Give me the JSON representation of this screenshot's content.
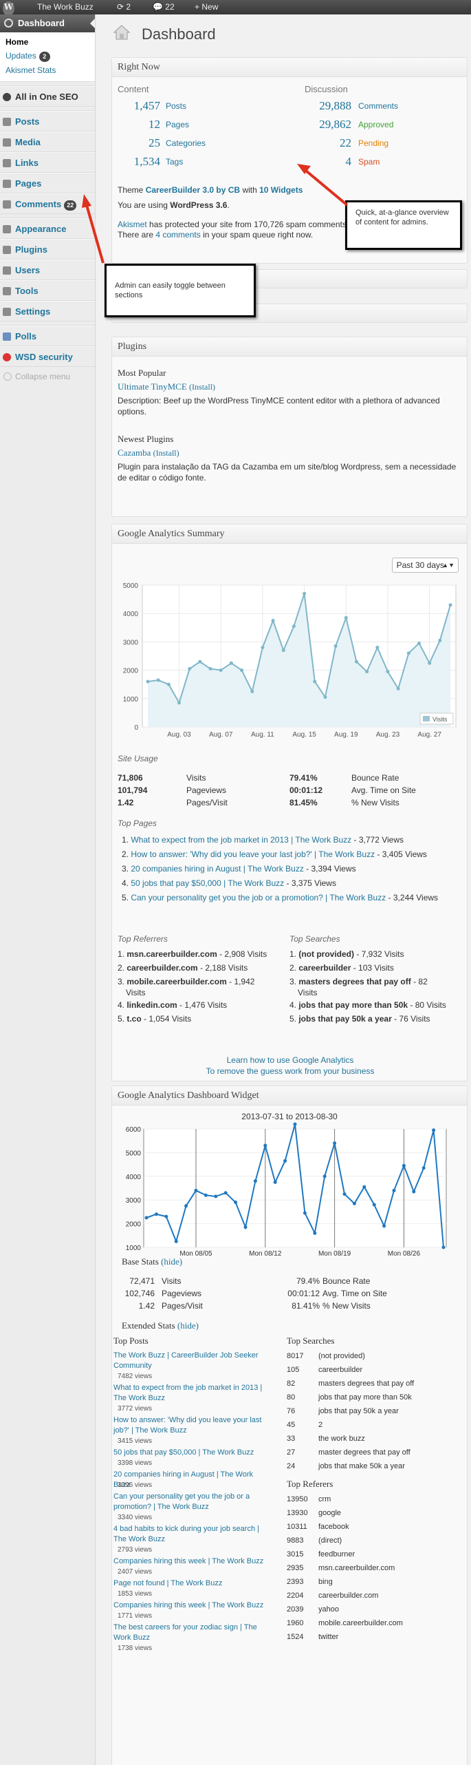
{
  "adminbar": {
    "site": "The Work Buzz",
    "updates": "2",
    "comments": "22",
    "new": "New"
  },
  "sidebar": {
    "dashboard": "Dashboard",
    "sub": [
      {
        "label": "Home"
      },
      {
        "label": "Updates",
        "badge": "2"
      },
      {
        "label": "Akismet Stats"
      }
    ],
    "items": [
      {
        "label": "All in One SEO"
      },
      {
        "label": "Posts"
      },
      {
        "label": "Media"
      },
      {
        "label": "Links"
      },
      {
        "label": "Pages"
      },
      {
        "label": "Comments",
        "badge": "22"
      },
      {
        "label": "Appearance"
      },
      {
        "label": "Plugins"
      },
      {
        "label": "Users"
      },
      {
        "label": "Tools"
      },
      {
        "label": "Settings"
      },
      {
        "label": "Polls"
      },
      {
        "label": "WSD security"
      }
    ],
    "collapse": "Collapse menu"
  },
  "page_title": "Dashboard",
  "right_now": {
    "title": "Right Now",
    "content_head": "Content",
    "discussion_head": "Discussion",
    "content": [
      {
        "n": "1,457",
        "l": "Posts"
      },
      {
        "n": "12",
        "l": "Pages"
      },
      {
        "n": "25",
        "l": "Categories"
      },
      {
        "n": "1,534",
        "l": "Tags"
      }
    ],
    "discussion": [
      {
        "n": "29,888",
        "l": "Comments"
      },
      {
        "n": "29,862",
        "l": "Approved"
      },
      {
        "n": "22",
        "l": "Pending"
      },
      {
        "n": "4",
        "l": "Spam"
      }
    ],
    "theme_pre": "Theme",
    "theme": "CareerBuilder 3.0 by CB",
    "theme_mid": "with",
    "widgets": "10 Widgets",
    "version_pre": "You are using",
    "version": "WordPress 3.6",
    "akismet": "Akismet",
    "akismet_text": "has protected your site from 170,726 spam comments",
    "spam_queue_pre": "There are",
    "spam_queue_link": "4 comments",
    "spam_queue_post": "in your spam queue right now."
  },
  "callouts": {
    "right": "Quick, at-a-glance overview of content for admins.",
    "left": "Admin can easily toggle between sections"
  },
  "plugins": {
    "title": "Plugins",
    "most_popular": "Most Popular",
    "mp_name": "Ultimate TinyMCE",
    "install": "(Install)",
    "mp_desc": "Description: Beef up the WordPress TinyMCE content editor with a plethora of advanced options.",
    "newest": "Newest Plugins",
    "np_name": "Cazamba",
    "np_desc": "Plugin para instalação da TAG da Cazamba em um site/blog Wordpress, sem a necessidade de editar o código fonte."
  },
  "ga_summary": {
    "title": "Google Analytics Summary",
    "range": "Past 30 days",
    "legend": "Visits",
    "site_usage": "Site Usage",
    "stats": [
      {
        "v": "71,806",
        "l": "Visits",
        "v2": "79.41%",
        "l2": "Bounce Rate"
      },
      {
        "v": "101,794",
        "l": "Pageviews",
        "v2": "00:01:12",
        "l2": "Avg. Time on Site"
      },
      {
        "v": "1.42",
        "l": "Pages/Visit",
        "v2": "81.45%",
        "l2": "% New Visits"
      }
    ],
    "top_pages_head": "Top Pages",
    "top_pages": [
      {
        "link": "What to expect from the job market in 2013 | The Work Buzz",
        "views": "- 3,772 Views"
      },
      {
        "link": "How to answer: 'Why did you leave your last job?' | The Work Buzz",
        "views": "- 3,405 Views"
      },
      {
        "link": "20 companies hiring in August | The Work Buzz",
        "views": "- 3,394 Views"
      },
      {
        "link": "50 jobs that pay $50,000 | The Work Buzz",
        "views": "- 3,375 Views"
      },
      {
        "link": "Can your personality get you the job or a promotion? | The Work Buzz",
        "views": "- 3,244 Views"
      }
    ],
    "referrers_head": "Top Referrers",
    "referrers": [
      {
        "b": "msn.careerbuilder.com",
        "v": "- 2,908 Visits"
      },
      {
        "b": "careerbuilder.com",
        "v": "- 2,188 Visits"
      },
      {
        "b": "mobile.careerbuilder.com",
        "v": "- 1,942"
      },
      {
        "b": "linkedin.com",
        "v": "- 1,476 Visits"
      },
      {
        "b": "t.co",
        "v": "- 1,054 Visits"
      }
    ],
    "ref3_cont": "Visits",
    "searches_head": "Top Searches",
    "searches": [
      {
        "b": "(not provided)",
        "v": "- 7,932 Visits"
      },
      {
        "b": "careerbuilder",
        "v": "- 103 Visits"
      },
      {
        "b": "masters degrees that pay off",
        "v": "- 82"
      },
      {
        "b": "jobs that pay more than 50k",
        "v": "- 80 Visits"
      },
      {
        "b": "jobs that pay 50k a year",
        "v": "- 76 Visits"
      }
    ],
    "s3_cont": "Visits",
    "learn": "Learn how to use Google Analytics",
    "remove": "To remove the guess work from your business"
  },
  "ga_widget": {
    "title": "Google Analytics Dashboard Widget",
    "range_title": "2013-07-31 to 2013-08-30",
    "base_stats": "Base Stats",
    "hide": "(hide)",
    "stats": [
      {
        "v": "72,471",
        "l": "Visits",
        "v2": "79.4%",
        "l2": "Bounce Rate"
      },
      {
        "v": "102,746",
        "l": "Pageviews",
        "v2": "00:01:12",
        "l2": "Avg. Time on Site"
      },
      {
        "v": "1.42",
        "l": "Pages/Visit",
        "v2": "81.41%",
        "l2": "% New Visits"
      }
    ],
    "extended": "Extended Stats",
    "top_posts_head": "Top Posts",
    "top_posts": [
      {
        "t": "The Work Buzz | CareerBuilder Job Seeker Community",
        "v": "7482 views"
      },
      {
        "t": "What to expect from the job market in 2013 | The Work Buzz",
        "v": "3772 views"
      },
      {
        "t": "How to answer: 'Why did you leave your last job?' | The Work Buzz",
        "v": "3415 views"
      },
      {
        "t": "50 jobs that pay $50,000 | The Work Buzz",
        "v": "3398 views"
      },
      {
        "t": "20 companies hiring in August | The Work Buzz",
        "v": "3396 views"
      },
      {
        "t": "Can your personality get you the job or a promotion? | The Work Buzz",
        "v": "3340 views"
      },
      {
        "t": "4 bad habits to kick during your job search | The Work Buzz",
        "v": "2793 views"
      },
      {
        "t": "Companies hiring this week | The Work Buzz",
        "v": "2407 views"
      },
      {
        "t": "Page not found | The Work Buzz",
        "v": "1853 views"
      },
      {
        "t": "Companies hiring this week | The Work Buzz",
        "v": "1771 views"
      },
      {
        "t": "The best careers for your zodiac sign | The Work Buzz",
        "v": "1738 views"
      }
    ],
    "top_searches_head": "Top Searches",
    "top_searches": [
      {
        "n": "8017",
        "t": "(not provided)"
      },
      {
        "n": "105",
        "t": "careerbuilder"
      },
      {
        "n": "82",
        "t": "masters degrees that pay off"
      },
      {
        "n": "80",
        "t": "jobs that pay more than 50k"
      },
      {
        "n": "76",
        "t": "jobs that pay 50k a year"
      },
      {
        "n": "45",
        "t": "2"
      },
      {
        "n": "33",
        "t": "the work buzz"
      },
      {
        "n": "27",
        "t": "master degrees that pay off"
      },
      {
        "n": "24",
        "t": "jobs that make 50k a year"
      }
    ],
    "top_referers_head": "Top Referers",
    "top_referers": [
      {
        "n": "13950",
        "t": "crm"
      },
      {
        "n": "13930",
        "t": "google"
      },
      {
        "n": "10311",
        "t": "facebook"
      },
      {
        "n": "9883",
        "t": "(direct)"
      },
      {
        "n": "3015",
        "t": "feedburner"
      },
      {
        "n": "2935",
        "t": "msn.careerbuilder.com"
      },
      {
        "n": "2393",
        "t": "bing"
      },
      {
        "n": "2204",
        "t": "careerbuilder.com"
      },
      {
        "n": "2039",
        "t": "yahoo"
      },
      {
        "n": "1960",
        "t": "mobile.careerbuilder.com"
      },
      {
        "n": "1524",
        "t": "twitter"
      }
    ]
  },
  "chart_data": [
    {
      "type": "area",
      "title": "",
      "xlabel": "",
      "ylabel": "",
      "x_ticks": [
        "Aug. 03",
        "Aug. 07",
        "Aug. 11",
        "Aug. 15",
        "Aug. 19",
        "Aug. 23",
        "Aug. 27"
      ],
      "ylim": [
        0,
        5000
      ],
      "y_ticks": [
        0,
        1000,
        2000,
        3000,
        4000,
        5000
      ],
      "series": [
        {
          "name": "Visits",
          "values": [
            1600,
            1650,
            1500,
            850,
            2050,
            2300,
            2050,
            2000,
            2250,
            2000,
            1250,
            2800,
            3750,
            2700,
            3550,
            4700,
            1600,
            1050,
            2850,
            3850,
            2300,
            1950,
            2800,
            1950,
            1350,
            2600,
            2950,
            2250,
            3050,
            4300
          ]
        }
      ],
      "legend": "bottom-right",
      "grid": true
    },
    {
      "type": "line",
      "title": "2013-07-31 to 2013-08-30",
      "xlabel": "",
      "ylabel": "",
      "x_ticks": [
        "Mon 08/05",
        "Mon 08/12",
        "Mon 08/19",
        "Mon 08/26"
      ],
      "ylim": [
        1000,
        6000
      ],
      "y_ticks": [
        1000,
        2000,
        3000,
        4000,
        5000,
        6000
      ],
      "series": [
        {
          "values": [
            2250,
            2400,
            2300,
            1250,
            2750,
            3400,
            3200,
            3150,
            3300,
            2900,
            1850,
            3800,
            5300,
            3750,
            4650,
            6200,
            2450,
            1600,
            4000,
            5400,
            3250,
            2850,
            3550,
            2800,
            1900,
            3400,
            4450,
            3350,
            4350,
            5950,
            1000
          ]
        }
      ],
      "grid": true
    }
  ]
}
